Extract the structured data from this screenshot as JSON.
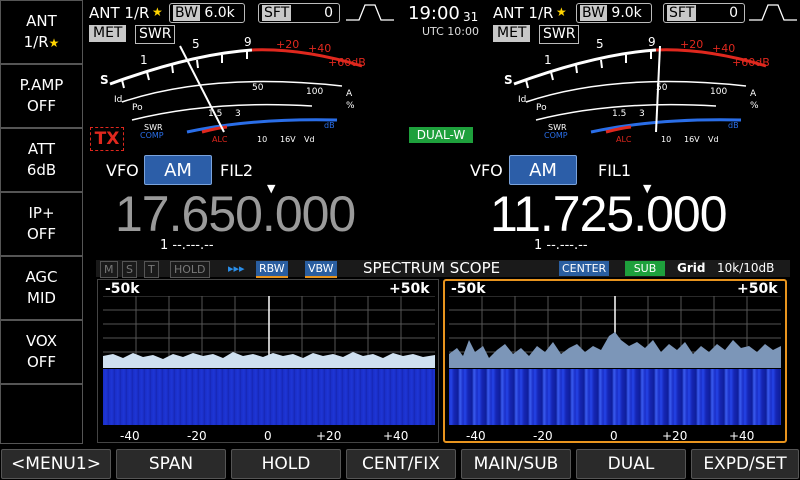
{
  "left_buttons": [
    {
      "label": "ANT",
      "value": "1/R",
      "star": "★"
    },
    {
      "label": "P.AMP",
      "value": "OFF"
    },
    {
      "label": "ATT",
      "value": "6dB"
    },
    {
      "label": "IP+",
      "value": "OFF"
    },
    {
      "label": "AGC",
      "value": "MID"
    },
    {
      "label": "VOX",
      "value": "OFF"
    }
  ],
  "main": {
    "ant": "ANT 1/R",
    "star": "★",
    "bw_label": "BW",
    "bw_value": "6.0k",
    "sft_label": "SFT",
    "sft_value": "0",
    "met": "MET",
    "swr": "SWR",
    "tx": "TX",
    "vfo": "VFO",
    "mode": "AM",
    "filter": "FIL2",
    "frequency": "17.650.000",
    "mem": "1 --.---.--"
  },
  "sub": {
    "ant": "ANT 1/R",
    "star": "★",
    "bw_label": "BW",
    "bw_value": "9.0k",
    "sft_label": "SFT",
    "sft_value": "0",
    "met": "MET",
    "swr": "SWR",
    "dual": "DUAL-W",
    "vfo": "VFO",
    "mode": "AM",
    "filter": "FIL1",
    "frequency": "11.725.000",
    "mem": "1 --.---.--"
  },
  "clock": {
    "time": "19:00",
    "seconds": "31",
    "utc": "UTC 10:00"
  },
  "meter_labels": {
    "s": "S",
    "po": "Po",
    "swr": "SWR",
    "comp": "COMP",
    "alc": "ALC",
    "id": "Id",
    "a": "A",
    "percent": "%",
    "vd": "Vd",
    "db": "dB",
    "s_scale": [
      "1",
      "3",
      "5",
      "7",
      "9"
    ],
    "plus_scale": [
      "+20",
      "+40",
      "+60dB"
    ],
    "po_scale": [
      "0",
      "10",
      "25",
      "50",
      "100"
    ],
    "swr_scale": [
      "1",
      "1.5",
      "2",
      "3"
    ],
    "alc_scale": [
      "0",
      "5",
      "10",
      "15",
      "20"
    ],
    "id_scale": [
      "10",
      "15",
      "16V"
    ]
  },
  "scope": {
    "indicators": [
      "M",
      "S",
      "T",
      "HOLD"
    ],
    "arrows": "▸▸▸",
    "rbw": "RBW",
    "vbw": "VBW",
    "title": "SPECTRUM SCOPE",
    "center": "CENTER",
    "sub": "SUB",
    "grid": "Grid",
    "range": "10k/10dB",
    "span_left": "-50k",
    "span_right": "+50k",
    "x_ticks": [
      "-40",
      "-20",
      "0",
      "+20",
      "+40"
    ]
  },
  "bottom_buttons": [
    "<MENU1>",
    "SPAN",
    "HOLD",
    "CENT/FIX",
    "MAIN/SUB",
    "DUAL",
    "EXPD/SET"
  ],
  "colors": {
    "accent_blue": "#2c5ea8",
    "red": "#e0281e",
    "orange_frame": "#e8941e",
    "green": "#1ea03c",
    "waterfall": "#1a2fc8"
  }
}
